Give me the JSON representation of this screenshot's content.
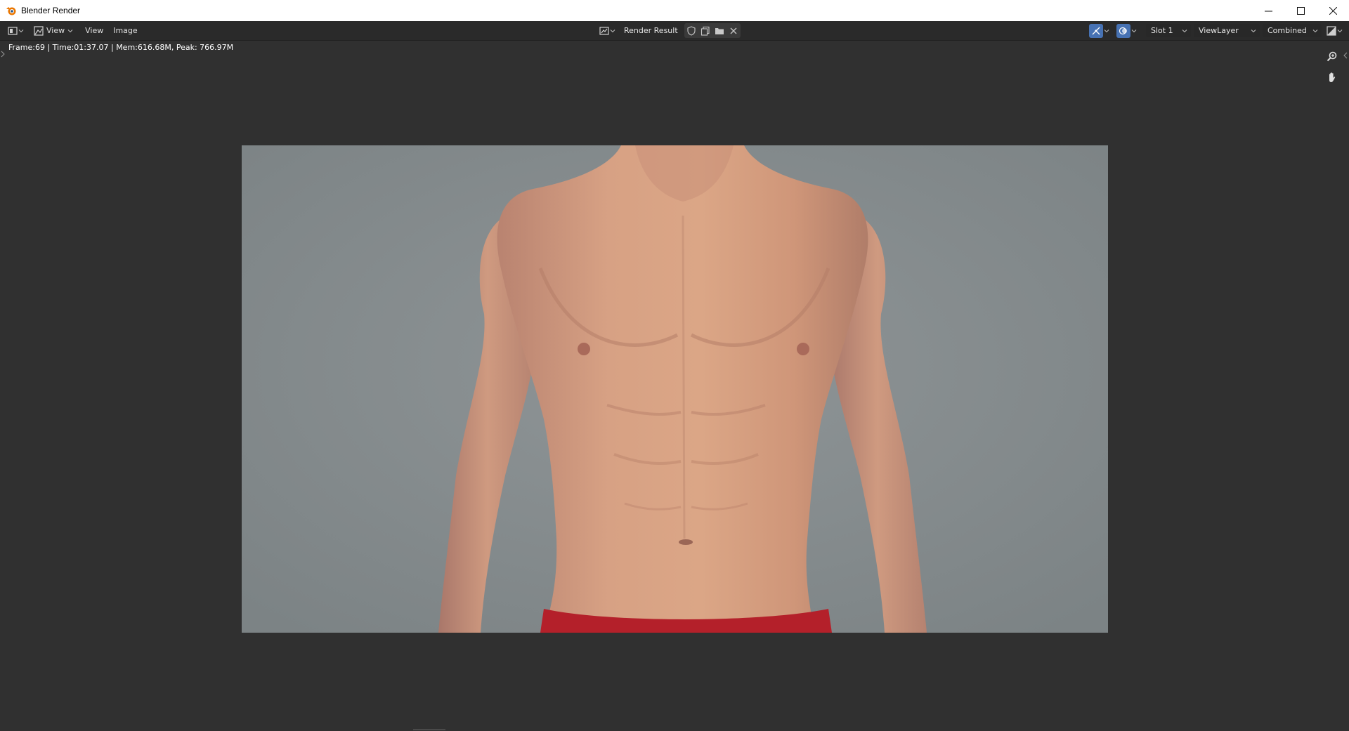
{
  "window": {
    "title": "Blender Render",
    "controls": [
      "minimize",
      "maximize",
      "close"
    ]
  },
  "header": {
    "editor_type_icon": "image-editor-icon",
    "menus": [
      "View",
      "View",
      "Image"
    ],
    "image_name": "Render Result",
    "slot": "Slot 1",
    "view_layer": "ViewLayer",
    "pass": "Combined"
  },
  "stats": "Frame:69 | Time:01:37.07 | Mem:616.68M, Peak: 766.97M",
  "colors": {
    "header_bg": "#2a2a2a",
    "viewport_bg": "#303030",
    "accent": "#4772b3",
    "skin": "#d7a184",
    "shorts": "#b4202a"
  }
}
